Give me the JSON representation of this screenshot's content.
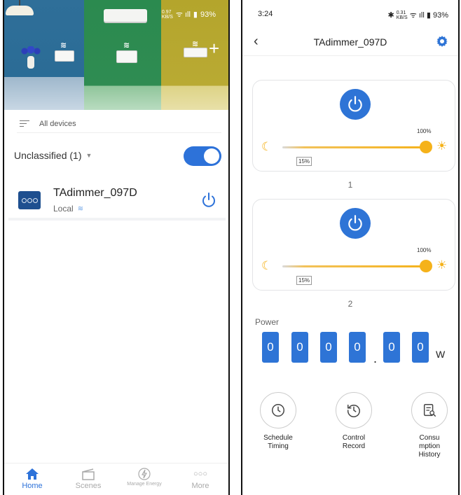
{
  "left": {
    "status_bar": {
      "speed": "0.97",
      "speed_unit": "KB/S",
      "battery": "93%"
    },
    "all_devices_label": "All devices",
    "group_label": "Unclassified (1)",
    "group_toggle_on": true,
    "device": {
      "name": "TAdimmer_097D",
      "connection": "Local"
    },
    "tabs": [
      {
        "label": "Home",
        "active": true
      },
      {
        "label": "Scenes",
        "active": false
      },
      {
        "label": "Manage Energy",
        "active": false
      },
      {
        "label": "More",
        "active": false
      }
    ],
    "colors": {
      "accent": "#2d72d9"
    }
  },
  "right": {
    "status_bar": {
      "time": "3:24",
      "speed": "0.31",
      "speed_unit": "KB/S",
      "battery": "93%"
    },
    "header": {
      "title": "TAdimmer_097D"
    },
    "channels": [
      {
        "label": "1",
        "brightness_text": "100%",
        "brightness": 100,
        "min_text": "15%"
      },
      {
        "label": "2",
        "brightness_text": "100%",
        "brightness": 100,
        "min_text": "15%"
      }
    ],
    "power": {
      "label": "Power",
      "digits": [
        "0",
        "0",
        "0",
        "0",
        "0",
        "0"
      ],
      "decimal": ".",
      "unit": "W"
    },
    "functions": [
      {
        "label": "Schedule Timing",
        "icon": "clock-icon"
      },
      {
        "label": "Control Record",
        "icon": "history-icon"
      },
      {
        "label": "Consu mption History",
        "icon": "report-icon"
      }
    ],
    "colors": {
      "accent": "#2e74d6",
      "slider": "#f5b21a"
    }
  }
}
